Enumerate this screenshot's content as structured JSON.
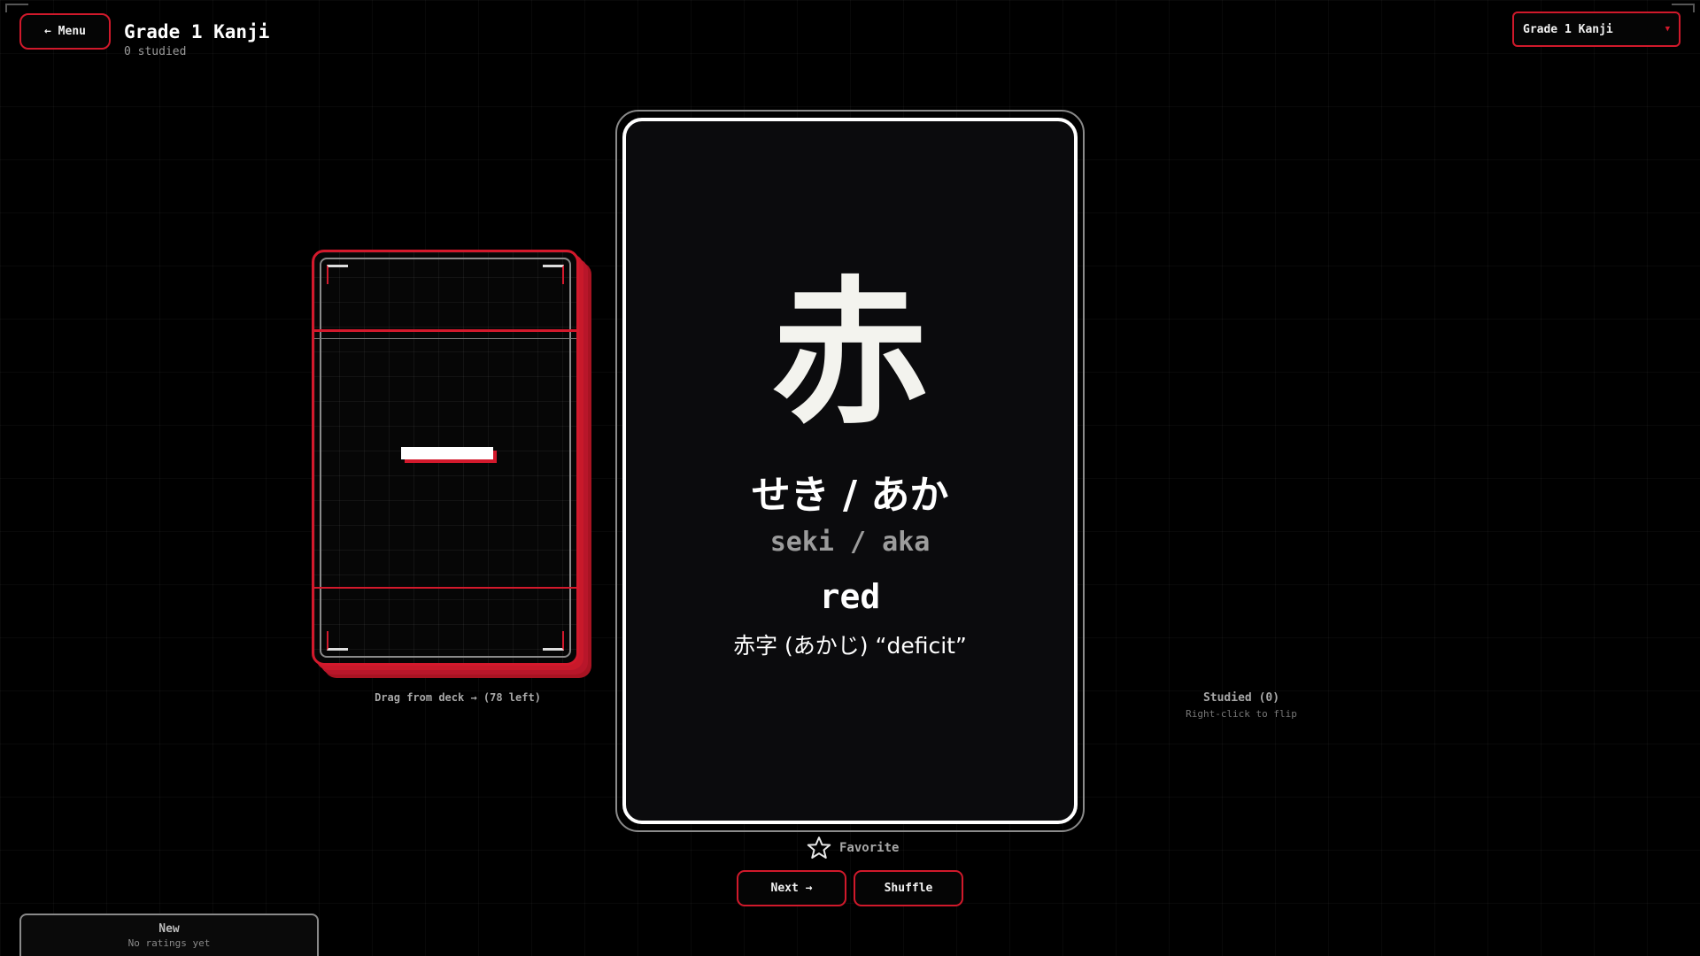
{
  "header": {
    "menu_label": "← Menu",
    "deck_title": "Grade 1 Kanji",
    "studied_count": "0 studied",
    "deck_select_value": "Grade 1 Kanji"
  },
  "deck": {
    "card_face": "一",
    "caption": "Drag from deck →  (78 left)"
  },
  "card": {
    "kanji": "赤",
    "reading_kana": "せき / あか",
    "reading_romaji": "seki / aka",
    "meaning": "red",
    "example": "赤字 (あかじ) “deficit”"
  },
  "actions": {
    "favorite_label": "Favorite",
    "next_label": "Next →",
    "shuffle_label": "Shuffle"
  },
  "studied_pile": {
    "label": "Studied (0)",
    "hint": "Right-click to flip"
  },
  "rating": {
    "title": "New",
    "subtitle": "No ratings yet"
  },
  "colors": {
    "accent": "#d0192b",
    "background": "#000000",
    "card": "#0b0b0d"
  },
  "icons": {
    "favorite": "star-outline-icon",
    "select_caret": "chevron-down-icon"
  }
}
